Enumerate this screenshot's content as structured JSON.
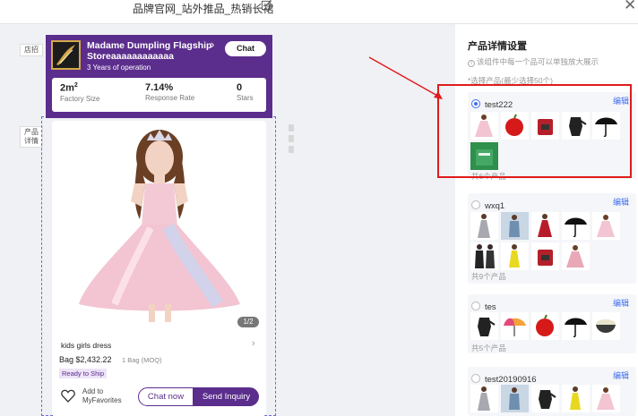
{
  "topbar": {
    "title": "品牌官网_站外推品_热销长裙"
  },
  "left": {
    "shop_label": "店招",
    "detail_label": "产品\n详情"
  },
  "store": {
    "name": "Madame Dumpling Flagship Storeaaaaaaaaaaaa",
    "years": "3 Years of operation",
    "chat": "Chat",
    "stats": [
      {
        "value": "2m",
        "sup": "2",
        "label": "Factory Size"
      },
      {
        "value": "7.14%",
        "label": "Response Rate"
      },
      {
        "value": "0",
        "label": "Stars"
      }
    ]
  },
  "product": {
    "counter": "1/2",
    "name": "kids girls dress",
    "price": "Bag $2,432.22",
    "moq": "1 Bag (MOQ)",
    "badge": "Ready to Ship",
    "fav": "Add to MyFavorites",
    "chat_now": "Chat now",
    "inquiry": "Send Inquiry"
  },
  "right_panel": {
    "title": "产品详情设置",
    "hint": "该组件中每一个品可以单独放大展示",
    "sub": "*选择产品(最少选择50个)",
    "edit_label": "编辑",
    "groups": [
      {
        "name": "test222",
        "checked": true,
        "count": "共6个产品",
        "thumbs": [
          "dress-pink-icon",
          "apple-icon",
          "coffee-machine-icon",
          "moka-pot-icon",
          "umbrella-black-icon",
          "green-bag-icon"
        ]
      },
      {
        "name": "wxq1",
        "checked": false,
        "count": "共9个产品",
        "thumbs": [
          "gown-gray-icon",
          "jacket-blue-icon",
          "dress-red-icon",
          "umbrella-black-icon",
          "dress-pink-icon",
          "coat-black-icon",
          "dress-yellow-icon",
          "coffee-machine-icon",
          "dress-pink-icon"
        ]
      },
      {
        "name": "tes",
        "checked": false,
        "count": "共5个产品",
        "thumbs": [
          "moka-pot-icon",
          "umbrella-rainbow-icon",
          "apple-icon",
          "umbrella-black-icon",
          "rice-bowl-icon"
        ]
      },
      {
        "name": "test20190916",
        "checked": false,
        "count": "",
        "thumbs": [
          "gown-gray-icon",
          "jacket-blue-icon",
          "moka-pot-icon",
          "dress-yellow-icon",
          "dress-pink-icon"
        ]
      }
    ]
  },
  "colors": {
    "brand": "#5b2d8c",
    "accent": "#3d6df2",
    "highlight": "#e01b1b"
  }
}
